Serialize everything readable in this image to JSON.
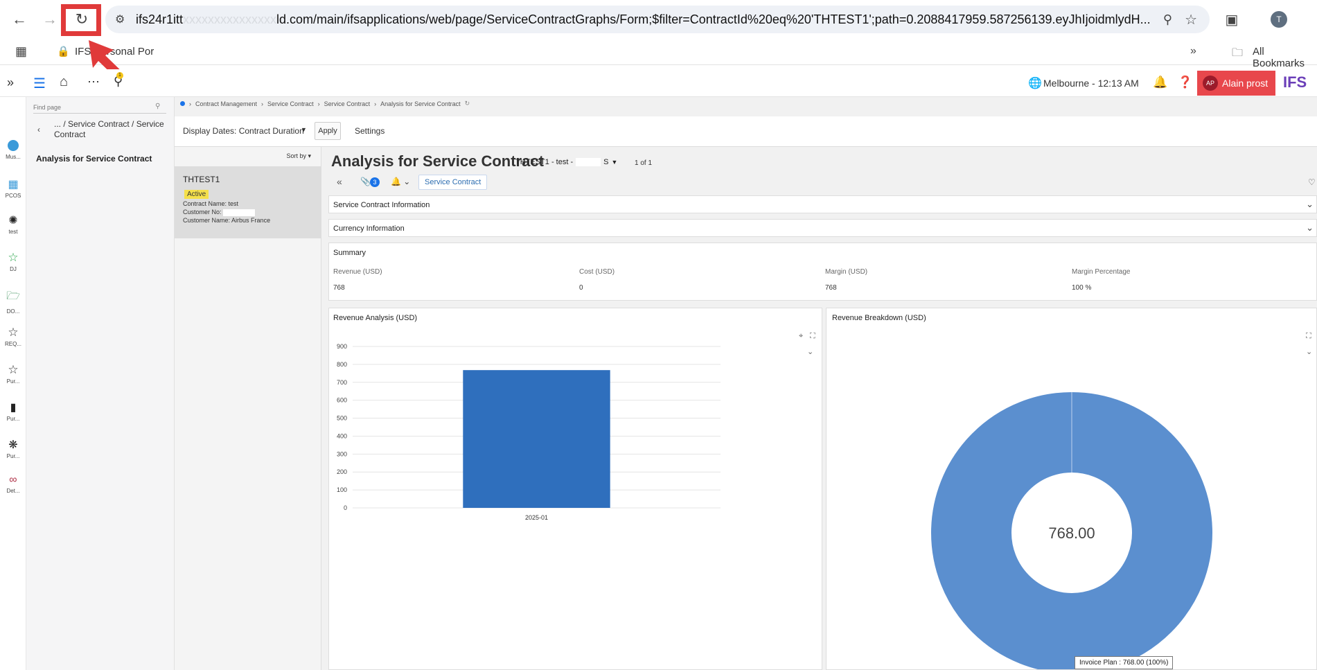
{
  "browser": {
    "url_visible_start": "ifs24r1itt",
    "url_visible_end": "ld.com/main/ifsapplications/web/page/ServiceContractGraphs/Form;$filter=ContractId%20eq%20'THTEST1';path=0.2088417959.587256139.eyJhIjoidmlydH...",
    "profile_initial": "T",
    "bookmark_1": "IFS Personal Por",
    "all_bookmarks": "All Bookmarks"
  },
  "app_header": {
    "location_time": "Melbourne - 12:13 AM",
    "user_initials": "AP",
    "user_name": "Alain prost",
    "brand": "IFS",
    "search_badge": "1"
  },
  "rail": {
    "items": [
      {
        "label": "Mus..."
      },
      {
        "label": "PCOS"
      },
      {
        "label": "test"
      },
      {
        "label": "DJ"
      },
      {
        "label": "DO..."
      },
      {
        "label": "REQ..."
      },
      {
        "label": "Pur..."
      },
      {
        "label": "Pur..."
      },
      {
        "label": "Pur..."
      },
      {
        "label": "Det..."
      }
    ]
  },
  "nav": {
    "find_placeholder": "Find page",
    "back_path": "... / Service Contract / Service Contract",
    "current": "Analysis for Service Contract"
  },
  "breadcrumb": {
    "items": [
      "Contract Management",
      "Service Contract",
      "Service Contract",
      "Analysis for Service Contract"
    ]
  },
  "toolbar": {
    "display_dates": "Display Dates: Contract Duration",
    "apply": "Apply",
    "settings": "Settings"
  },
  "list": {
    "sort_by": "Sort by",
    "record": {
      "id": "THTEST1",
      "status": "Active",
      "contract_name_label": "Contract Name:",
      "contract_name": "test",
      "customer_no_label": "Customer No:",
      "customer_name_label": "Customer Name:",
      "customer_name": "Airbus France"
    }
  },
  "page": {
    "title": "Analysis for Service Contract",
    "record_selector": "THTEST1 - test -",
    "record_selector_tail": "S",
    "pager": "1 of 1",
    "attachments_count": "3",
    "tab_service_contract": "Service Contract"
  },
  "sections": {
    "service_contract_info": "Service Contract Information",
    "currency_info": "Currency Information",
    "summary_title": "Summary",
    "summary": [
      {
        "label": "Revenue (USD)",
        "value": "768"
      },
      {
        "label": "Cost (USD)",
        "value": "0"
      },
      {
        "label": "Margin (USD)",
        "value": "768"
      },
      {
        "label": "Margin Percentage",
        "value": "100 %"
      }
    ]
  },
  "chart_data": [
    {
      "type": "bar",
      "title": "Revenue Analysis (USD)",
      "categories": [
        "2025-01"
      ],
      "values": [
        768
      ],
      "ylim": [
        0,
        900
      ],
      "yticks": [
        "0",
        "100",
        "200",
        "300",
        "400",
        "500",
        "600",
        "700",
        "800",
        "900"
      ],
      "grid": true,
      "color": "#2f6fbd"
    },
    {
      "type": "pie",
      "title": "Revenue Breakdown (USD)",
      "slices": [
        {
          "label": "Invoice Plan",
          "value": 768
        }
      ],
      "center_label": "768.00",
      "tooltip": "Invoice Plan : 768.00 (100%)",
      "color": "#5b8fcf"
    }
  ],
  "colors": {
    "user_chip": "#e8474c",
    "highlight": "#e03a3a",
    "bar": "#2f6fbd",
    "donut": "#5b8fcf",
    "status_badge": "#f5e04a"
  }
}
